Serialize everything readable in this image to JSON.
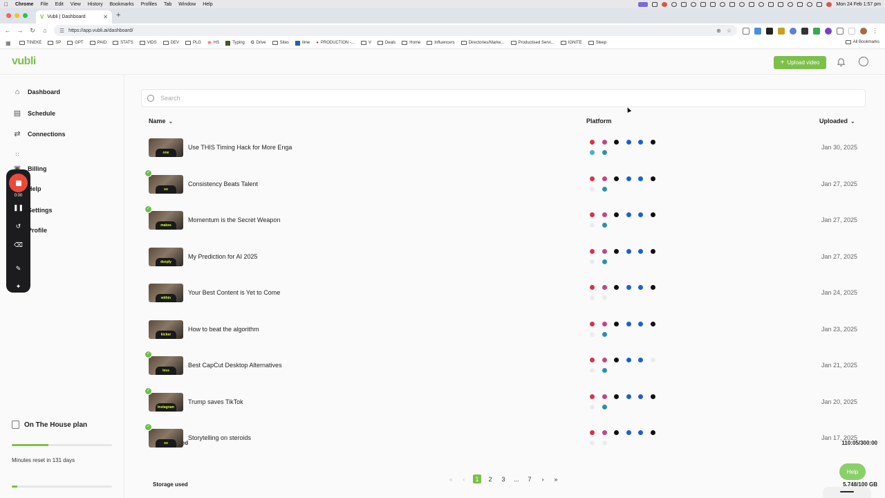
{
  "menubar": {
    "app": "Chrome",
    "items": [
      "File",
      "Edit",
      "View",
      "History",
      "Bookmarks",
      "Profiles",
      "Tab",
      "Window",
      "Help"
    ],
    "clock": "Mon 24 Feb  1:57 pm"
  },
  "browser": {
    "tab_title": "Vubli | Dashboard",
    "url": "https://app.vubli.ai/dashboard/",
    "bookmarks": [
      "TINEKE",
      "SP",
      "GPT",
      "PAID",
      "STATS",
      "VIDS",
      "DEV",
      "PLG",
      "HS",
      "Typing",
      "Drive",
      "Sites",
      "time",
      "PRODUCTION -...",
      "V",
      "Deals",
      "Home",
      "Influencers",
      "Directories/Marke...",
      "Productised Servi...",
      "IGNITE",
      "Sleep"
    ],
    "all_bookmarks": "All Bookmarks"
  },
  "header": {
    "logo": "vubli",
    "upload_label": "Upload video"
  },
  "sidebar": {
    "items": [
      {
        "label": "Dashboard",
        "icon": "home-icon"
      },
      {
        "label": "Schedule",
        "icon": "calendar-icon"
      },
      {
        "label": "Connections",
        "icon": "arrows-icon"
      },
      {
        "label": "Billing",
        "icon": "card-icon"
      },
      {
        "label": "Help",
        "icon": "help-icon"
      },
      {
        "label": "Settings",
        "icon": "gear-icon"
      },
      {
        "label": "Profile",
        "icon": "user-icon"
      }
    ],
    "plan": "On The House plan",
    "minutes_label": "Minutes used",
    "minutes_value": "110:05/300:00",
    "minutes_fraction": 0.367,
    "reset_text": "Minutes reset in 131 days",
    "storage_label": "Storage used",
    "storage_value": "5.748/100 GB",
    "storage_fraction": 0.057
  },
  "recorder": {
    "time": "0:00"
  },
  "search": {
    "placeholder": "Search"
  },
  "table": {
    "col_name": "Name",
    "col_platform": "Platform",
    "col_uploaded": "Uploaded",
    "platform_colors": [
      "#d8334a",
      "#c4457f",
      "#111111",
      "#1d5fd0",
      "#1d5fd0",
      "#111111",
      "#3fb2dc",
      "#2a8fb8"
    ],
    "rows": [
      {
        "name": "Use THIS Timing Hack for More Enga",
        "date": "Jan 30, 2025",
        "caption": "one",
        "checked": false,
        "active": [
          1,
          1,
          1,
          1,
          1,
          1,
          1,
          1
        ]
      },
      {
        "name": "Consistency Beats Talent",
        "date": "Jan 27, 2025",
        "caption": "so",
        "checked": true,
        "active": [
          1,
          1,
          1,
          1,
          1,
          1,
          0,
          1
        ]
      },
      {
        "name": "Momentum is the Secret Weapon",
        "date": "Jan 27, 2025",
        "caption": "makes",
        "checked": true,
        "active": [
          1,
          1,
          1,
          1,
          1,
          1,
          0,
          1
        ]
      },
      {
        "name": "My Prediction for AI 2025",
        "date": "Jan 27, 2025",
        "caption": "deeply",
        "checked": false,
        "active": [
          1,
          1,
          1,
          1,
          1,
          1,
          0,
          1
        ]
      },
      {
        "name": "Your Best Content is Yet to Come",
        "date": "Jan 24, 2025",
        "caption": "within",
        "checked": false,
        "active": [
          1,
          1,
          1,
          1,
          1,
          1,
          0,
          0
        ]
      },
      {
        "name": "How to beat the algorithm",
        "date": "Jan 23, 2025",
        "caption": "kicker",
        "checked": false,
        "active": [
          1,
          1,
          1,
          1,
          1,
          1,
          0,
          1
        ]
      },
      {
        "name": "Best CapCut Desktop Alternatives",
        "date": "Jan 21, 2025",
        "caption": "less",
        "checked": true,
        "active": [
          1,
          1,
          1,
          1,
          1,
          0,
          0,
          1
        ]
      },
      {
        "name": "Trump saves TikTok",
        "date": "Jan 20, 2025",
        "caption": "Instagram",
        "checked": true,
        "active": [
          1,
          1,
          1,
          1,
          1,
          1,
          0,
          1
        ]
      },
      {
        "name": "Storytelling on steroids",
        "date": "Jan 17, 2025",
        "caption": "so",
        "checked": true,
        "active": [
          1,
          1,
          1,
          1,
          1,
          1,
          0,
          0
        ]
      }
    ]
  },
  "pagination": {
    "pages": [
      "1",
      "2",
      "3",
      "...",
      "7"
    ],
    "current": "1"
  },
  "help_label": "Help"
}
